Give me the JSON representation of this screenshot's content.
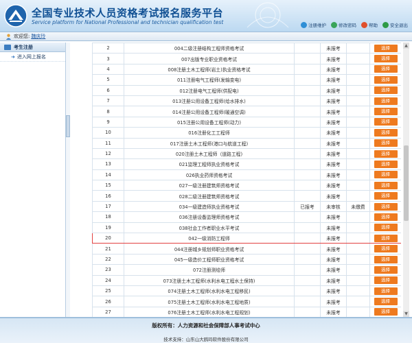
{
  "header": {
    "title": "全国专业技术人员资格考试报名服务平台",
    "subtitle": "Service platform for National Professional and technician qualification test",
    "links": [
      {
        "label": "注册维护",
        "icon": "user-edit-icon",
        "color": "#2f8fd6"
      },
      {
        "label": "修改密码",
        "icon": "key-icon",
        "color": "#3aa55a"
      },
      {
        "label": "帮助",
        "icon": "help-icon",
        "color": "#e0502c"
      },
      {
        "label": "安全退出",
        "icon": "power-icon",
        "color": "#2e9b46"
      }
    ]
  },
  "userbar": {
    "welcome": "欢迎您:",
    "username": "魏庆玲"
  },
  "sidebar": {
    "section": "考生注册",
    "items": [
      {
        "label": "进入网上报名"
      }
    ]
  },
  "exam_table": {
    "rows": [
      {
        "num": "2",
        "name": "004二级注册结构工程师资格考试",
        "s1": "",
        "s2": "未报考",
        "s3": "",
        "action": "选择",
        "highlight": false
      },
      {
        "num": "3",
        "name": "007出版专业职业资格考试",
        "s1": "",
        "s2": "未报考",
        "s3": "",
        "action": "选择",
        "highlight": false
      },
      {
        "num": "4",
        "name": "008注册土木工程师(岩土)执业资格考试",
        "s1": "",
        "s2": "未报考",
        "s3": "",
        "action": "选择",
        "highlight": false
      },
      {
        "num": "5",
        "name": "011注册电气工程师(发输变电)",
        "s1": "",
        "s2": "未报考",
        "s3": "",
        "action": "选择",
        "highlight": false
      },
      {
        "num": "6",
        "name": "012注册电气工程师(供配电)",
        "s1": "",
        "s2": "未报考",
        "s3": "",
        "action": "选择",
        "highlight": false
      },
      {
        "num": "7",
        "name": "013注册公用设备工程师(给水排水)",
        "s1": "",
        "s2": "未报考",
        "s3": "",
        "action": "选择",
        "highlight": false
      },
      {
        "num": "8",
        "name": "014注册公用设备工程师(暖通空调)",
        "s1": "",
        "s2": "未报考",
        "s3": "",
        "action": "选择",
        "highlight": false
      },
      {
        "num": "9",
        "name": "015注册公用设备工程师(动力)",
        "s1": "",
        "s2": "未报考",
        "s3": "",
        "action": "选择",
        "highlight": false
      },
      {
        "num": "10",
        "name": "016注册化工工程师",
        "s1": "",
        "s2": "未报考",
        "s3": "",
        "action": "选择",
        "highlight": false
      },
      {
        "num": "11",
        "name": "017注册土木工程师(港口与航道工程)",
        "s1": "",
        "s2": "未报考",
        "s3": "",
        "action": "选择",
        "highlight": false
      },
      {
        "num": "12",
        "name": "020注册土木工程师（道路工程)",
        "s1": "",
        "s2": "未报考",
        "s3": "",
        "action": "选择",
        "highlight": false
      },
      {
        "num": "13",
        "name": "021监理工程师执业资格考试",
        "s1": "",
        "s2": "未报考",
        "s3": "",
        "action": "选择",
        "highlight": false
      },
      {
        "num": "14",
        "name": "026执业药师资格考试",
        "s1": "",
        "s2": "未报考",
        "s3": "",
        "action": "选择",
        "highlight": false
      },
      {
        "num": "15",
        "name": "027一级注册建筑师资格考试",
        "s1": "",
        "s2": "未报考",
        "s3": "",
        "action": "选择",
        "highlight": false
      },
      {
        "num": "16",
        "name": "028二级注册建筑师资格考试",
        "s1": "",
        "s2": "未报考",
        "s3": "",
        "action": "选择",
        "highlight": false
      },
      {
        "num": "17",
        "name": "034一级建造师执业资格考试",
        "s1": "已报考",
        "s2": "未审核",
        "s3": "未缴费",
        "action": "选择",
        "highlight": false
      },
      {
        "num": "18",
        "name": "036注册设备监理师资格考试",
        "s1": "",
        "s2": "未报考",
        "s3": "",
        "action": "选择",
        "highlight": false
      },
      {
        "num": "19",
        "name": "038社会工作者职业水平考试",
        "s1": "",
        "s2": "未报考",
        "s3": "",
        "action": "选择",
        "highlight": false
      },
      {
        "num": "20",
        "name": "042一级消防工程师",
        "s1": "",
        "s2": "未报考",
        "s3": "",
        "action": "选择",
        "highlight": true
      },
      {
        "num": "21",
        "name": "044注册城乡规划师职业资格考试",
        "s1": "",
        "s2": "未报考",
        "s3": "",
        "action": "选择",
        "highlight": false
      },
      {
        "num": "22",
        "name": "045一级造价工程师职业资格考试",
        "s1": "",
        "s2": "未报考",
        "s3": "",
        "action": "选择",
        "highlight": false
      },
      {
        "num": "23",
        "name": "072注册测绘师",
        "s1": "",
        "s2": "未报考",
        "s3": "",
        "action": "选择",
        "highlight": false
      },
      {
        "num": "24",
        "name": "073注册土木工程师(水利水电工程水土保持)",
        "s1": "",
        "s2": "未报考",
        "s3": "",
        "action": "选择",
        "highlight": false
      },
      {
        "num": "25",
        "name": "074注册土木工程师(水利水电工程移民)",
        "s1": "",
        "s2": "未报考",
        "s3": "",
        "action": "选择",
        "highlight": false
      },
      {
        "num": "26",
        "name": "075注册土木工程师(水利水电工程地质)",
        "s1": "",
        "s2": "未报考",
        "s3": "",
        "action": "选择",
        "highlight": false
      },
      {
        "num": "27",
        "name": "076注册土木工程师(水利水电工程规划)",
        "s1": "",
        "s2": "未报考",
        "s3": "",
        "action": "选择",
        "highlight": false
      }
    ]
  },
  "colors": {
    "accent": "#ee7a1f",
    "highlight_border": "#e24040",
    "brand": "#0f4f93"
  },
  "footer": {
    "copyright": "版权所有：人力资源和社会保障部人事考试中心",
    "tech": "技术支持：山东山大鸥玛软件股份有限公司"
  }
}
